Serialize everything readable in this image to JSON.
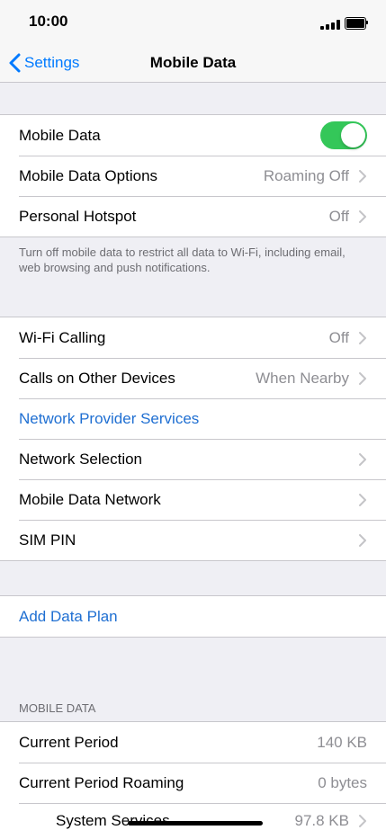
{
  "status_bar": {
    "time": "10:00"
  },
  "nav": {
    "back_label": "Settings",
    "title": "Mobile Data"
  },
  "group1": {
    "mobile_data": {
      "label": "Mobile Data",
      "toggle_on": true
    },
    "options": {
      "label": "Mobile Data Options",
      "value": "Roaming Off"
    },
    "hotspot": {
      "label": "Personal Hotspot",
      "value": "Off"
    }
  },
  "note": "Turn off mobile data to restrict all data to Wi-Fi, including email, web browsing and push notifications.",
  "group2": {
    "wifi_calling": {
      "label": "Wi-Fi Calling",
      "value": "Off"
    },
    "calls_other": {
      "label": "Calls on Other Devices",
      "value": "When Nearby"
    },
    "provider_services": {
      "label": "Network Provider Services"
    },
    "network_selection": {
      "label": "Network Selection"
    },
    "data_network": {
      "label": "Mobile Data Network"
    },
    "sim_pin": {
      "label": "SIM PIN"
    }
  },
  "group3": {
    "add_plan": {
      "label": "Add Data Plan"
    }
  },
  "usage": {
    "header": "MOBILE DATA",
    "current_period": {
      "label": "Current Period",
      "value": "140 KB"
    },
    "current_roaming": {
      "label": "Current Period Roaming",
      "value": "0 bytes"
    },
    "system_services": {
      "label": "System Services",
      "value": "97.8 KB"
    }
  },
  "colors": {
    "accent": "#007aff",
    "link": "#1f6fd2",
    "toggle_on": "#34c759",
    "secondary_text": "#8e8e93",
    "background": "#efeff4"
  }
}
